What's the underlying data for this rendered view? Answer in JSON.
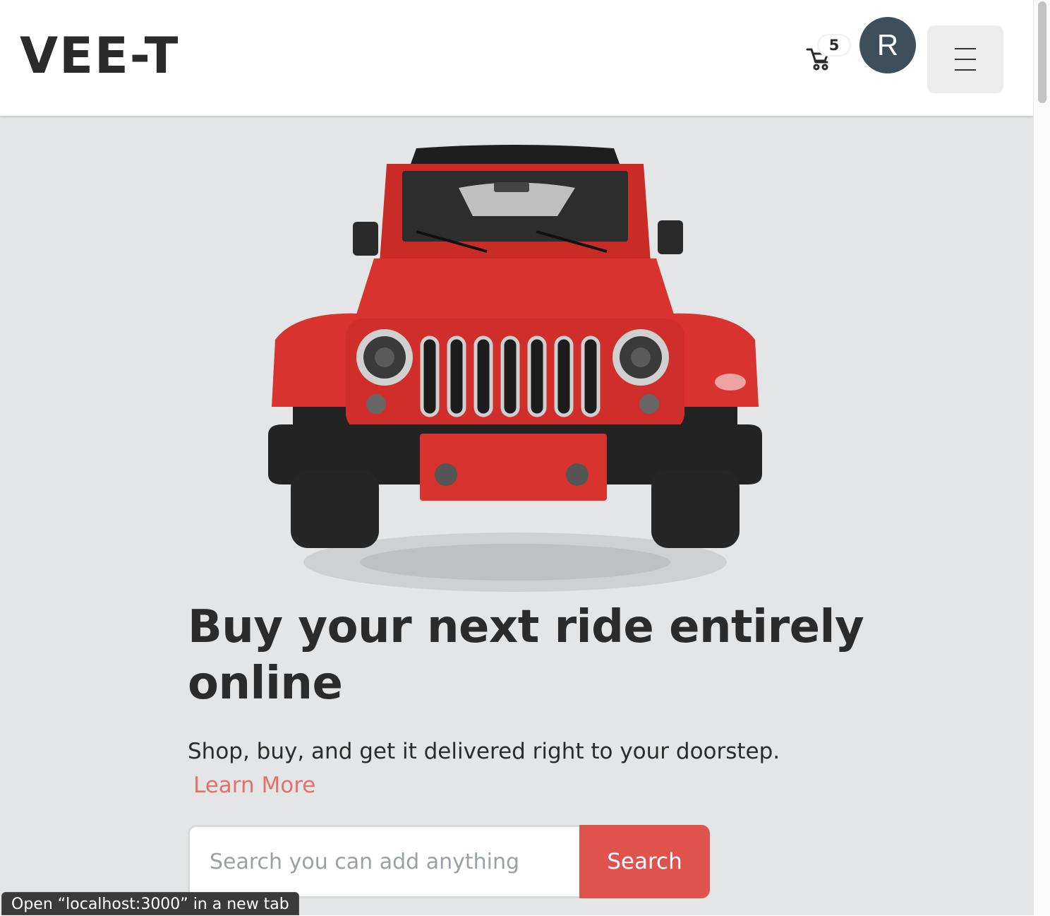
{
  "header": {
    "logo": "VEE-T",
    "cart_count": "5",
    "avatar_initial": "R"
  },
  "hero": {
    "image": "red-jeep-front-view",
    "headline": "Buy your next ride entirely online",
    "subtext": "Shop, buy, and get it delivered right to your doorstep.",
    "learn_more": "Learn More"
  },
  "search": {
    "placeholder": "Search you can add anything",
    "button": "Search"
  },
  "status_bar": {
    "text": "Open “localhost:3000” in a new tab"
  },
  "colors": {
    "page_bg": "#e3e5e6",
    "header_bg": "#ffffff",
    "avatar_bg": "#3d4f5a",
    "accent": "#e0524c",
    "link": "#e6716a",
    "text": "#2b2b2b",
    "jeep_red": "#d8332f"
  }
}
